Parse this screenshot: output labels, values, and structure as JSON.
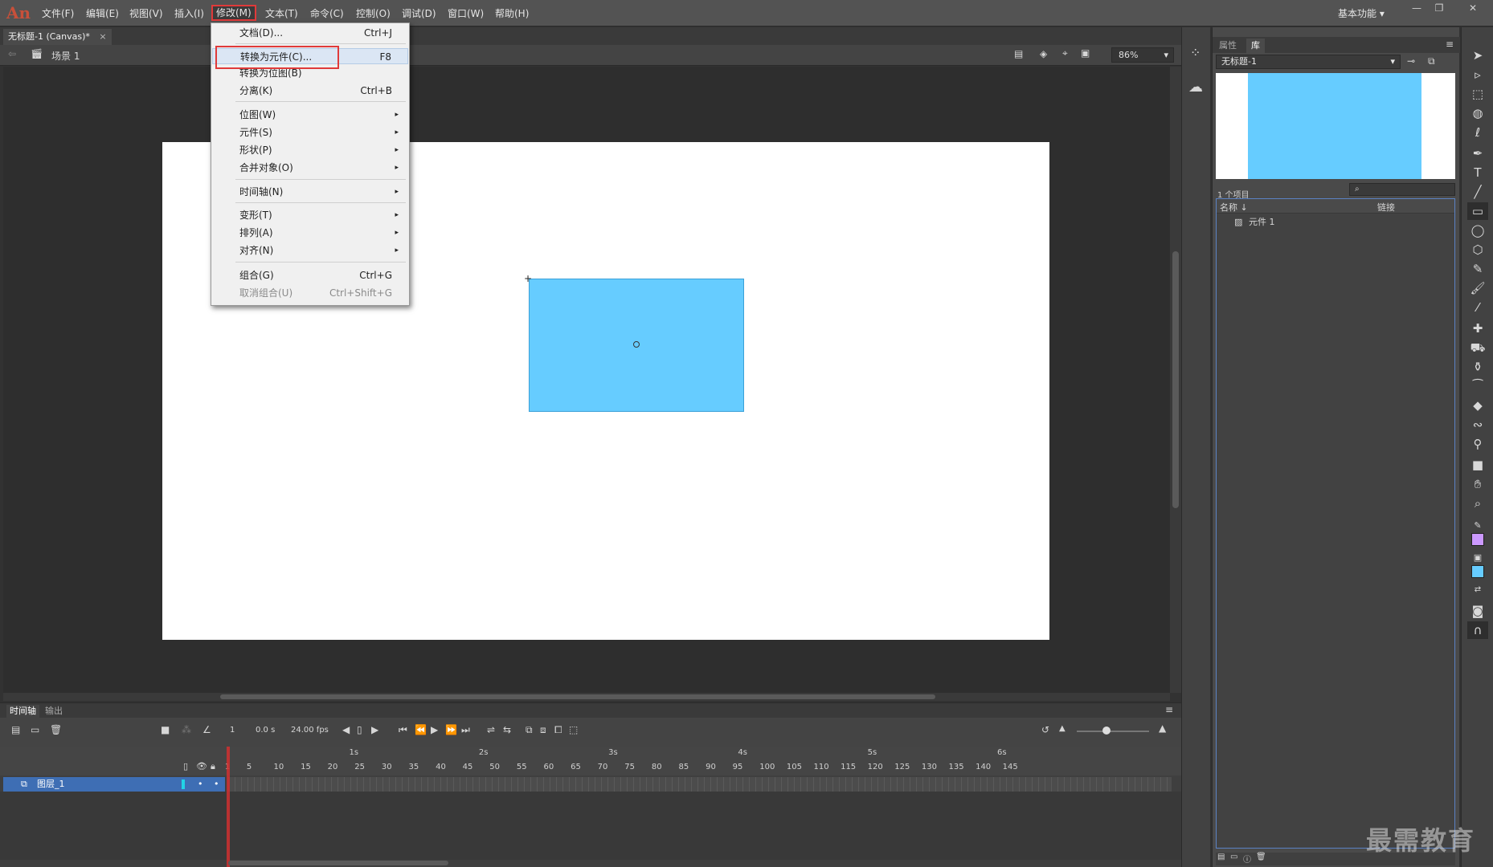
{
  "app": {
    "logo": "An"
  },
  "menubar": {
    "items": [
      "文件(F)",
      "编辑(E)",
      "视图(V)",
      "插入(I)",
      "修改(M)",
      "文本(T)",
      "命令(C)",
      "控制(O)",
      "调试(D)",
      "窗口(W)",
      "帮助(H)"
    ],
    "workspace": "基本功能",
    "window_controls": [
      "—",
      "❐",
      "✕"
    ]
  },
  "document": {
    "tab_title": "无标题-1 (Canvas)*",
    "tab_close": "×"
  },
  "editbar": {
    "scene_label": "场景 1",
    "zoom": "86%"
  },
  "dropdown": {
    "items": [
      {
        "label": "文档(D)...",
        "shortcut": "Ctrl+J"
      },
      {
        "label": "转换为元件(C)...",
        "shortcut": "F8"
      },
      {
        "label": "转换为位图(B)",
        "shortcut": ""
      },
      {
        "label": "分离(K)",
        "shortcut": "Ctrl+B"
      },
      {
        "label": "位图(W)",
        "shortcut": ""
      },
      {
        "label": "元件(S)",
        "shortcut": ""
      },
      {
        "label": "形状(P)",
        "shortcut": ""
      },
      {
        "label": "合并对象(O)",
        "shortcut": ""
      },
      {
        "label": "时间轴(N)",
        "shortcut": ""
      },
      {
        "label": "变形(T)",
        "shortcut": ""
      },
      {
        "label": "排列(A)",
        "shortcut": ""
      },
      {
        "label": "对齐(N)",
        "shortcut": ""
      },
      {
        "label": "组合(G)",
        "shortcut": "Ctrl+G"
      },
      {
        "label": "取消组合(U)",
        "shortcut": "Ctrl+Shift+G"
      }
    ],
    "submenu_arrow": "▸"
  },
  "library": {
    "tabs": [
      "属性",
      "库"
    ],
    "document_select": "无标题-1",
    "item_count": "1 个项目",
    "col_name": "名称 ↓",
    "col_linkage": "链接",
    "items": [
      "元件 1"
    ]
  },
  "timeline": {
    "tabs": [
      "时间轴",
      "输出"
    ],
    "current_frame": "1",
    "time": "0.0 s",
    "fps": "24.00 fps",
    "second_marks": [
      "1s",
      "2s",
      "3s",
      "4s",
      "5s",
      "6s"
    ],
    "frame_ticks": [
      "1",
      "5",
      "10",
      "15",
      "20",
      "25",
      "30",
      "35",
      "40",
      "45",
      "50",
      "55",
      "60",
      "65",
      "70",
      "75",
      "80",
      "85",
      "90",
      "95",
      "100",
      "105",
      "110",
      "115",
      "120",
      "125",
      "130",
      "135",
      "140",
      "145"
    ],
    "layer_name": "图层_1"
  },
  "watermark": "最需教育",
  "colors": {
    "shape_fill": "#66ccff",
    "highlight": "#e03a3a",
    "stroke_swatch": "#cc99ff",
    "fill_swatch": "#66ccff"
  }
}
